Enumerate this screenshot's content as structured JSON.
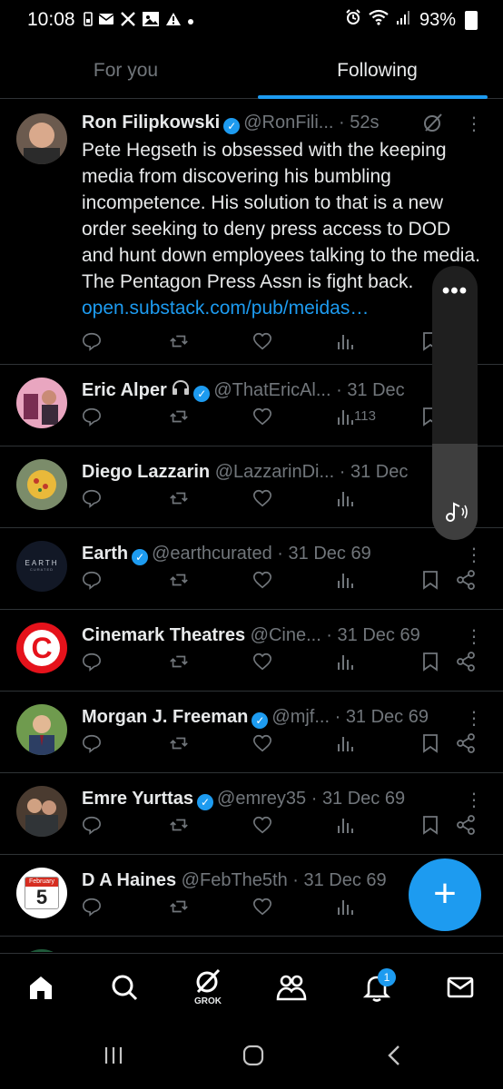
{
  "status_bar": {
    "time": "10:08",
    "battery": "93%",
    "left_icons": [
      "sim-icon",
      "mail-icon",
      "x-icon",
      "gallery-icon",
      "warning-icon",
      "dot-icon"
    ],
    "right_icons": [
      "alarm-icon",
      "wifi-icon",
      "signal-icon",
      "battery-icon"
    ]
  },
  "tabs": [
    {
      "label": "For you",
      "active": false
    },
    {
      "label": "Following",
      "active": true
    }
  ],
  "tweets": [
    {
      "name": "Ron Filipkowski",
      "verified": true,
      "handle": "@RonFili...",
      "time": "52s",
      "grok_icon": true,
      "text": "Pete Hegseth is obsessed with the keeping media from discovering his bumbling incompetence. His solution to that is a new order seeking to deny press access to DOD and hunt down employees talking to the media. The Pentagon Press Assn is fight back. ",
      "link": "open.substack.com/pub/meidas…",
      "views": ""
    },
    {
      "name": "Eric Alper",
      "verified": true,
      "handle": "@ThatEricAl...",
      "time": "31 Dec",
      "headphones": true,
      "views": "113"
    },
    {
      "name": "Diego Lazzarin",
      "verified": false,
      "handle": "@LazzarinDi...",
      "time": "31 Dec",
      "views": ""
    },
    {
      "name": "Earth",
      "verified": true,
      "handle": "@earthcurated",
      "time": "31 Dec 69",
      "avatar_text": "EARTH",
      "avatar_subtext": "CURATED",
      "views": ""
    },
    {
      "name": "Cinemark Theatres",
      "verified": false,
      "handle": "@Cine...",
      "time": "31 Dec 69",
      "avatar_text": "C",
      "views": ""
    },
    {
      "name": "Morgan J. Freeman",
      "verified": true,
      "handle": "@mjf...",
      "time": "31 Dec 69",
      "views": ""
    },
    {
      "name": "Emre Yurttas",
      "verified": true,
      "handle": "@emrey35",
      "time": "31 Dec 69",
      "views": ""
    },
    {
      "name": "D A Haines",
      "verified": false,
      "handle": "@FebThe5th",
      "time": "31 Dec 69",
      "avatar_month": "February",
      "avatar_day": "5",
      "views": ""
    }
  ],
  "media_control": {
    "more_label": "•••",
    "level": 0.35
  },
  "fab": {
    "label": "+"
  },
  "bottom_nav": {
    "items": [
      "home-icon",
      "search-icon",
      "grok-icon",
      "communities-icon",
      "notifications-icon",
      "messages-icon"
    ],
    "grok_label": "GROK",
    "notifications_badge": "1"
  },
  "colors": {
    "accent": "#1d9bf0",
    "background": "#000000",
    "text": "#e7e9ea",
    "secondary_text": "#71767b",
    "divider": "#2f3336"
  }
}
